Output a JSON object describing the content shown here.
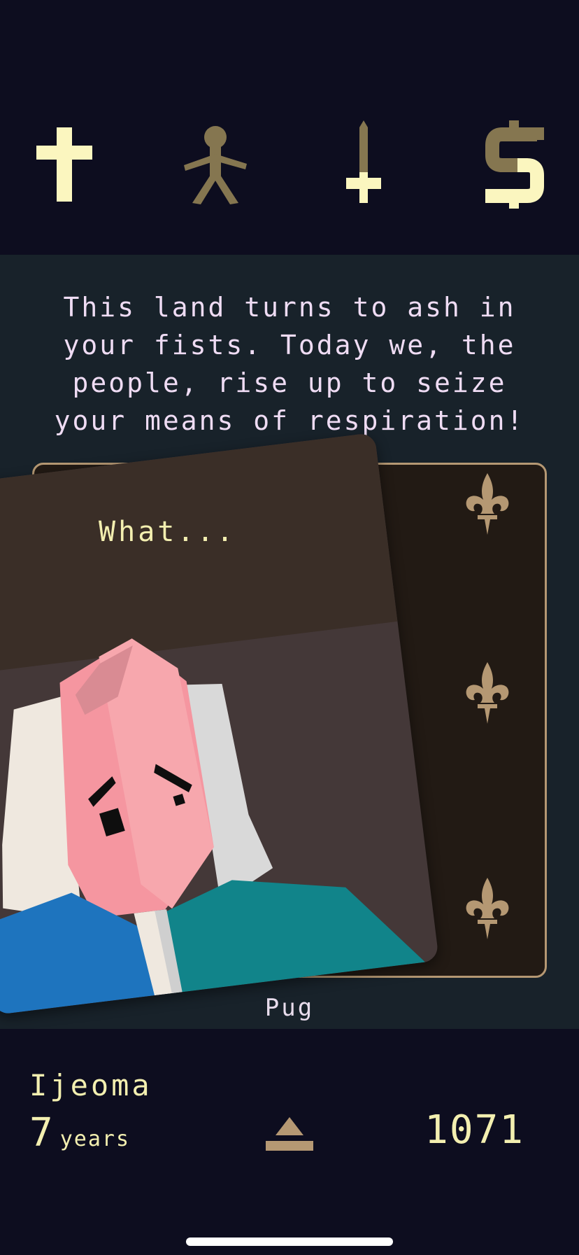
{
  "stats": [
    {
      "name": "church",
      "icon": "cross-icon",
      "fill_level": 1.0
    },
    {
      "name": "people",
      "icon": "person-icon",
      "fill_level": 0.0
    },
    {
      "name": "army",
      "icon": "sword-icon",
      "fill_level": 0.35
    },
    {
      "name": "treasury",
      "icon": "dollar-icon",
      "fill_level": 0.3
    }
  ],
  "prompt": {
    "text": "This land turns to ash in\nyour fists. Today we, the\npeople, rise up to seize\nyour means of respiration!"
  },
  "card": {
    "dialog": "What...",
    "character": "Pug"
  },
  "ruler": {
    "name": "Ijeoma",
    "reign_years": "7",
    "reign_unit": "years",
    "year": "1071"
  },
  "colors": {
    "stat_full": "#fbf6bf",
    "stat_empty": "#857650",
    "background_dark": "#0d0d1f",
    "background_mid": "#18222a",
    "text_yellow": "#f3efb0",
    "text_pink": "#efdcf4",
    "gold": "#b59873"
  }
}
